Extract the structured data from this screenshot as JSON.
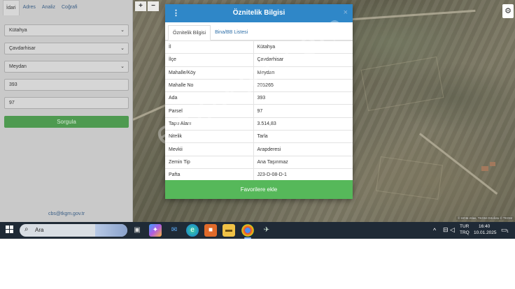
{
  "left_panel": {
    "tabs": [
      "İdari",
      "Adres",
      "Analiz",
      "Coğrafi"
    ],
    "fields": {
      "il": "Kütahya",
      "ilce": "Çavdarhisar",
      "mahalle": "Meydan",
      "ada": "393",
      "parsel": "97"
    },
    "query_button": "Sorgula",
    "email": "cbs@tkgm.gov.tr"
  },
  "map": {
    "zoom_in": "+",
    "zoom_out": "−",
    "settings_icon": "gear-icon",
    "attribution": "© HGM Atlas, TKGM Ortofoto © TKGM"
  },
  "modal": {
    "title": "Öznitelik Bilgisi",
    "tabs": [
      "Öznitelik Bilgisi",
      "Bina/BB Listesi"
    ],
    "rows": [
      {
        "key": "İl",
        "value": "Kütahya"
      },
      {
        "key": "İlçe",
        "value": "Çavdarhisar"
      },
      {
        "key": "Mahalle/Köy",
        "value": "Meydan"
      },
      {
        "key": "Mahalle No",
        "value": "205265"
      },
      {
        "key": "Ada",
        "value": "393"
      },
      {
        "key": "Parsel",
        "value": "97"
      },
      {
        "key": "Tapu Alanı",
        "value": "3.514,83"
      },
      {
        "key": "Nitelik",
        "value": "Tarla"
      },
      {
        "key": "Mevkii",
        "value": "Arapderesi"
      },
      {
        "key": "Zemin Tip",
        "value": "Ana Taşınmaz"
      },
      {
        "key": "Pafta",
        "value": "J23-D-08-D-1"
      }
    ],
    "favorite_button": "Favorilere ekle",
    "close": "×",
    "menu": "⋮"
  },
  "watermark": "emlakjet.com",
  "taskbar": {
    "search_placeholder": "Ara",
    "language_top": "TUR",
    "language_bottom": "TRQ",
    "time": "16:40",
    "date": "10.01.2025",
    "notification_count": "1"
  }
}
